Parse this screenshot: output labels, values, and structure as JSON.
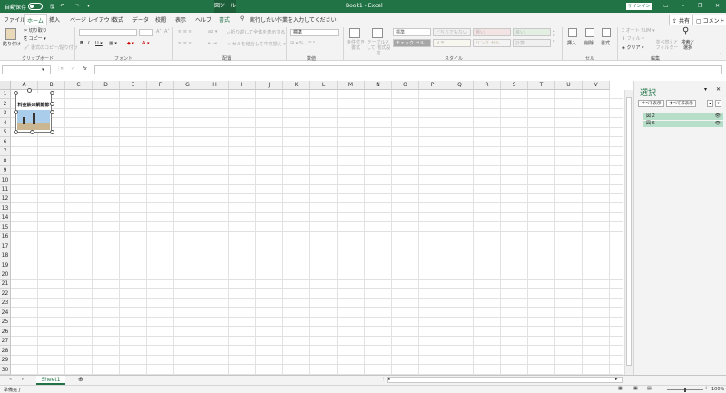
{
  "titlebar": {
    "autosave_label": "自動保存",
    "autosave_state": "オフ",
    "context_tab": "図ツール",
    "doc_title": "Book1 - Excel",
    "signin_label": "サインイン"
  },
  "tabs": [
    {
      "label": "ファイル"
    },
    {
      "label": "ホーム"
    },
    {
      "label": "挿入"
    },
    {
      "label": "ページ レイアウト"
    },
    {
      "label": "数式"
    },
    {
      "label": "データ"
    },
    {
      "label": "校閲"
    },
    {
      "label": "表示"
    },
    {
      "label": "ヘルプ"
    },
    {
      "label": "書式"
    }
  ],
  "tellme": "実行したい作業を入力してください",
  "share_label": "共有",
  "comment_label": "コメント",
  "ribbon": {
    "paste": "貼り付け",
    "cut": "切り取り",
    "copy": "コピー",
    "format_painter": "書式のコピー/貼り付け",
    "clipboard": "クリップボード",
    "font_group": "フォント",
    "align_group": "配置",
    "wrap": "折り返して全体を表示する",
    "merge": "セルを結合して中央揃え",
    "number_group": "数値",
    "number_format": "標準",
    "cond_format": "条件付き 書式",
    "table_format": "テーブルとして 書式設定",
    "style_group": "スタイル",
    "styles": [
      "標準",
      "どちらでもない",
      "悪い",
      "良い",
      "チェック セル",
      "メモ",
      "リンク セル",
      "計算"
    ],
    "insert": "挿入",
    "delete": "削除",
    "format": "書式",
    "cells_group": "セル",
    "autosum": "オート SUM",
    "fill": "フィル",
    "clear": "クリア",
    "sort": "並べ替えと フィルター",
    "find": "検索と 選択",
    "edit_group": "編集"
  },
  "formula_bar": {
    "fx": "fx",
    "name_box": "",
    "formula": ""
  },
  "columns": [
    "A",
    "B",
    "C",
    "D",
    "E",
    "F",
    "G",
    "H",
    "I",
    "J",
    "K",
    "L",
    "M",
    "N",
    "O",
    "P",
    "Q",
    "R",
    "S",
    "T",
    "U",
    "V"
  ],
  "rows": [
    "1",
    "2",
    "3",
    "4",
    "5",
    "6",
    "7",
    "8",
    "9",
    "10",
    "11",
    "12",
    "13",
    "14",
    "15",
    "16",
    "17",
    "18",
    "19",
    "20",
    "21",
    "22",
    "23",
    "24",
    "25",
    "26",
    "27",
    "28",
    "29",
    "30"
  ],
  "image_caption": "料金鉄の網節節",
  "sheet_tab": "Sheet1",
  "status_text": "準備完了",
  "zoom": "100%",
  "pane": {
    "title": "選択",
    "show_all": "すべて表示",
    "hide_all": "すべて非表示",
    "items": [
      {
        "label": "図 2",
        "eye": "👁"
      },
      {
        "label": "図 6",
        "eye": "👁"
      }
    ]
  }
}
